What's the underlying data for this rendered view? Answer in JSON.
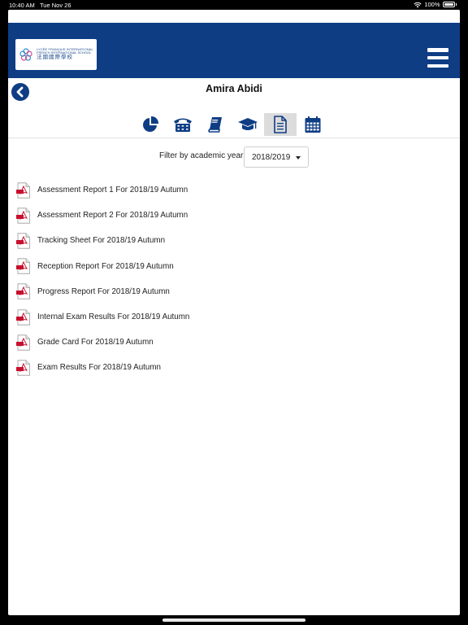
{
  "status": {
    "time": "10:40 AM",
    "date": "Tue Nov 26",
    "battery": "100%"
  },
  "header": {
    "logo_line1": "LYCÉE FRANÇAIS INTERNATIONAL",
    "logo_line2": "FRENCH INTERNATIONAL SCHOOL",
    "logo_line3": "法國國際學校",
    "brand_color": "#0f3d84"
  },
  "student": {
    "name": "Amira Abidi"
  },
  "tabs": [
    {
      "icon": "pie-chart-icon",
      "active": false
    },
    {
      "icon": "phone-icon",
      "active": false
    },
    {
      "icon": "book-icon",
      "active": false
    },
    {
      "icon": "graduation-cap-icon",
      "active": false
    },
    {
      "icon": "document-icon",
      "active": true
    },
    {
      "icon": "calendar-icon",
      "active": false
    }
  ],
  "filter": {
    "label": "Filter by academic year",
    "selected": "2018/2019"
  },
  "reports": [
    {
      "label": "Assessment Report 1 For 2018/19 Autumn"
    },
    {
      "label": "Assessment Report 2 For 2018/19 Autumn"
    },
    {
      "label": "Tracking Sheet For 2018/19 Autumn"
    },
    {
      "label": "Reception Report For 2018/19 Autumn"
    },
    {
      "label": "Progress Report For 2018/19 Autumn"
    },
    {
      "label": "Internal Exam Results For 2018/19 Autumn"
    },
    {
      "label": "Grade Card For 2018/19 Autumn"
    },
    {
      "label": "Exam Results For 2018/19 Autumn"
    }
  ]
}
